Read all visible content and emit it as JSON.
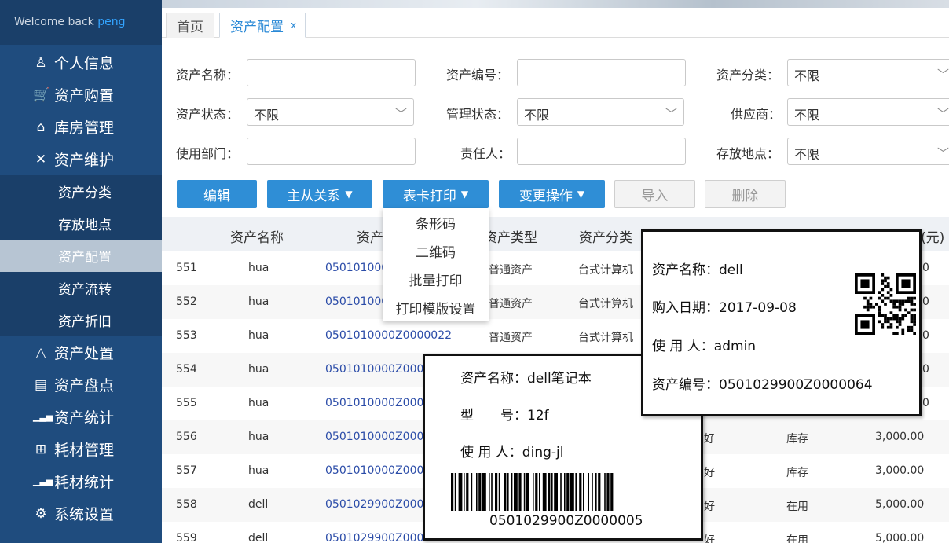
{
  "sidebar": {
    "welcome": "Welcome back",
    "user": "peng",
    "items": [
      {
        "label": "个人信息",
        "icon": "user-icon"
      },
      {
        "label": "资产购置",
        "icon": "cart-icon"
      },
      {
        "label": "库房管理",
        "icon": "warehouse-icon"
      },
      {
        "label": "资产维护",
        "icon": "tools-icon"
      }
    ],
    "subitems": [
      "资产分类",
      "存放地点",
      "资产配置",
      "资产流转",
      "资产折旧"
    ],
    "items2": [
      {
        "label": "资产处置",
        "icon": "disposal-icon"
      },
      {
        "label": "资产盘点",
        "icon": "clipboard-icon"
      },
      {
        "label": "资产统计",
        "icon": "bar-chart-icon"
      },
      {
        "label": "耗材管理",
        "icon": "grid-icon"
      },
      {
        "label": "耗材统计",
        "icon": "bar-chart-icon"
      },
      {
        "label": "系统设置",
        "icon": "gear-icon"
      }
    ]
  },
  "tabs": {
    "home": "首页",
    "current": "资产配置",
    "close": "x"
  },
  "filters": {
    "asset_name": "资产名称：",
    "asset_code": "资产编号：",
    "asset_category": "资产分类：",
    "asset_status": "资产状态：",
    "manage_status": "管理状态：",
    "supplier": "供应商：",
    "department": "使用部门：",
    "owner": "责任人：",
    "location": "存放地点：",
    "unlimited": "不限"
  },
  "toolbar": {
    "edit": "编辑",
    "relation": "主从关系",
    "card_print": "表卡打印",
    "change_ops": "变更操作",
    "import": "导入",
    "delete": "删除"
  },
  "dropdown": [
    "条形码",
    "二维码",
    "批量打印",
    "打印模版设置"
  ],
  "table": {
    "headers": [
      "资产名称",
      "资产",
      "资产类型",
      "资产分类",
      "(元)"
    ],
    "rows": [
      {
        "n": "551",
        "name": "hua",
        "code": "050101000",
        "type": "普通资产",
        "cat": "台式计算机",
        "c1": "",
        "c2": "",
        "price": ""
      },
      {
        "n": "552",
        "name": "hua",
        "code": "050101000",
        "type": "普通资产",
        "cat": "台式计算机",
        "c1": "",
        "c2": "",
        "price": ""
      },
      {
        "n": "553",
        "name": "hua",
        "code": "0501010000Z0000022",
        "type": "普通资产",
        "cat": "台式计算机",
        "c1": "",
        "c2": "",
        "price": ""
      },
      {
        "n": "554",
        "name": "hua",
        "code": "0501010000Z000",
        "type": "",
        "cat": "",
        "c1": "",
        "c2": "",
        "price": ""
      },
      {
        "n": "555",
        "name": "hua",
        "code": "0501010000Z000",
        "type": "",
        "cat": "",
        "c1": "",
        "c2": "",
        "price": ""
      },
      {
        "n": "556",
        "name": "hua",
        "code": "0501010000Z000",
        "type": "",
        "cat": "",
        "c1": "好",
        "c2": "库存",
        "price": "3,000.00"
      },
      {
        "n": "557",
        "name": "hua",
        "code": "0501010000Z000",
        "type": "",
        "cat": "",
        "c1": "好",
        "c2": "库存",
        "price": "3,000.00"
      },
      {
        "n": "558",
        "name": "dell",
        "code": "0501029900Z000",
        "type": "",
        "cat": "",
        "c1": "好",
        "c2": "在用",
        "price": "5,000.00"
      },
      {
        "n": "559",
        "name": "dell",
        "code": "0501029900Z000",
        "type": "",
        "cat": "",
        "c1": "好",
        "c2": "在用",
        "price": "5,000.00"
      }
    ],
    "peek_price": [
      "0",
      "0",
      "0",
      "0",
      "0"
    ]
  },
  "card_qr": {
    "name": "资产名称：dell",
    "date": "购入日期：2017-09-08",
    "user": "使 用 人：admin",
    "code": "资产编号：0501029900Z0000064"
  },
  "card_bar": {
    "name": "资产名称：dell笔记本",
    "model": "型　　号：12f",
    "user": "使 用 人：ding-jl",
    "barcode": "0501029900Z0000005"
  }
}
